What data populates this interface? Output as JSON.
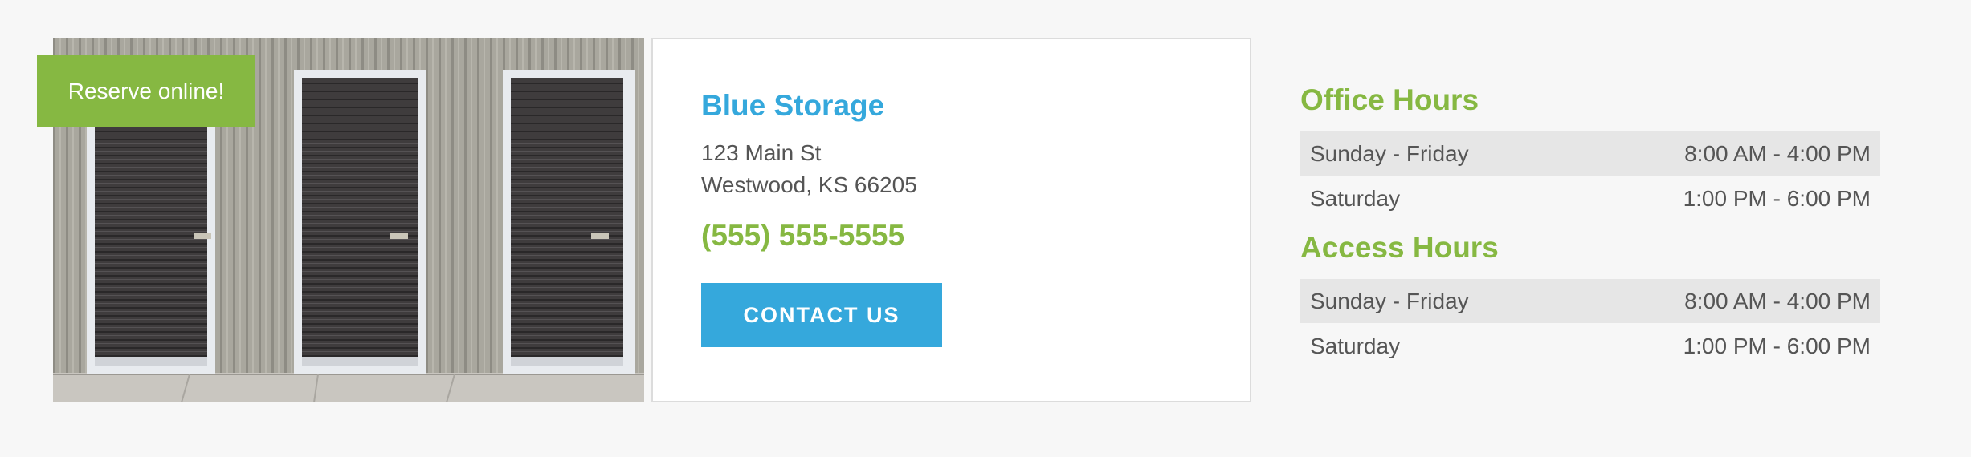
{
  "promo": {
    "reserve_label": "Reserve online!"
  },
  "facility": {
    "name": "Blue Storage",
    "address_line1": "123 Main St",
    "address_line2": "Westwood, KS 66205",
    "phone": "(555) 555-5555",
    "contact_label": "CONTACT US"
  },
  "office_hours": {
    "title": "Office Hours",
    "rows": [
      {
        "days": "Sunday - Friday",
        "hours": "8:00 AM - 4:00 PM"
      },
      {
        "days": "Saturday",
        "hours": "1:00 PM - 6:00 PM"
      }
    ]
  },
  "access_hours": {
    "title": "Access Hours",
    "rows": [
      {
        "days": "Sunday - Friday",
        "hours": "8:00 AM - 4:00 PM"
      },
      {
        "days": "Saturday",
        "hours": "1:00 PM - 6:00 PM"
      }
    ]
  },
  "colors": {
    "brand_blue": "#35a8dc",
    "brand_green": "#86b842",
    "text_gray": "#555555",
    "row_shade": "#e6e6e6"
  }
}
